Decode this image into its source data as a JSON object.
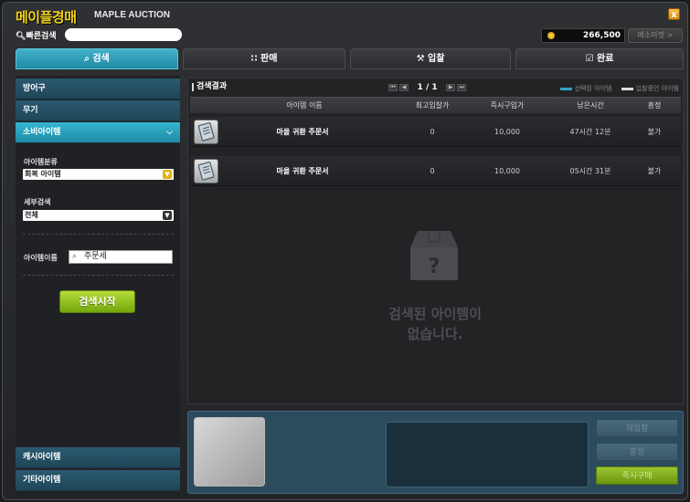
{
  "title": {
    "main": "메이플경매",
    "sub": "MAPLE AUCTION",
    "close": "x"
  },
  "quick_search": {
    "label": "빠른검색",
    "value": ""
  },
  "mesos": {
    "amount": "266,500",
    "market_label": "메소마켓 >"
  },
  "tabs": [
    {
      "label": "검색",
      "icon": "search-icon",
      "active": true
    },
    {
      "label": "판매",
      "icon": "sell-icon",
      "active": false
    },
    {
      "label": "입찰",
      "icon": "gavel-icon",
      "active": false
    },
    {
      "label": "완료",
      "icon": "check-icon",
      "active": false
    }
  ],
  "sidebar": {
    "categories": [
      {
        "label": "방어구"
      },
      {
        "label": "무기"
      },
      {
        "label": "소비아이템",
        "active": true
      }
    ],
    "filters": {
      "item_class_label": "아이템분류",
      "item_class_value": "회복 아이템",
      "detail_label": "세부검색",
      "detail_value": "전체",
      "name_label": "아이템이름",
      "name_value": "주문세"
    },
    "search_button": "검색시작",
    "bottom_categories": [
      {
        "label": "캐시아이템"
      },
      {
        "label": "기타아이템"
      }
    ]
  },
  "results": {
    "title": "검색결과",
    "page": "1 / 1",
    "legend": {
      "selected": "선택된 아이템",
      "bidding": "입찰중인 아이템"
    },
    "columns": [
      "아이템 이름",
      "최고입찰가",
      "즉시구입가",
      "남은시간",
      "흥정"
    ],
    "rows": [
      {
        "name": "마을 귀환 주문서",
        "top_bid": "0",
        "buyout": "10,000",
        "time_left": "47시간 12분",
        "negotiate": "불가"
      },
      {
        "name": "마을 귀환 주문서",
        "top_bid": "0",
        "buyout": "10,000",
        "time_left": "05시간 31분",
        "negotiate": "불가"
      }
    ],
    "empty_line1": "검색된 아이템이",
    "empty_line2": "없습니다.",
    "empty_mark": "?"
  },
  "actions": {
    "rebid": "재입찰",
    "negotiate": "흥정",
    "buy_now": "즉시구매"
  },
  "colors": {
    "accent": "#2ea3bd",
    "title": "#f2d21a",
    "buy": "#8ab82a"
  }
}
